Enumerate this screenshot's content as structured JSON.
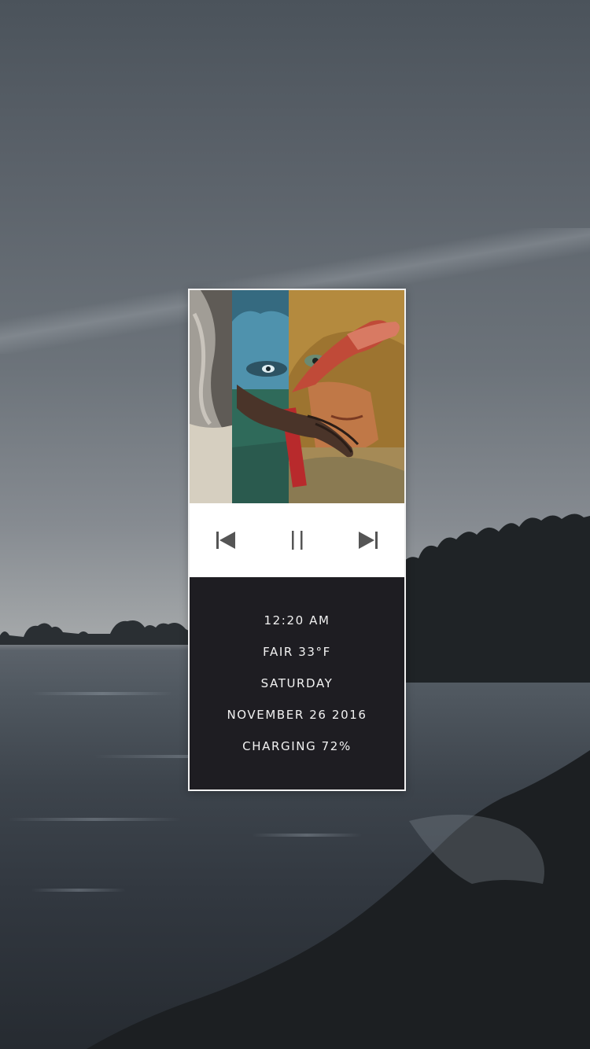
{
  "widget": {
    "controls": {
      "previous_icon": "skip-previous-icon",
      "pause_icon": "pause-icon",
      "next_icon": "skip-next-icon",
      "icon_color": "#555555"
    },
    "info": {
      "time": "12:20 AM",
      "weather": "FAIR 33°F",
      "day": "SATURDAY",
      "date": "NOVEMBER 26 2016",
      "battery": "CHARGING 72%"
    },
    "colors": {
      "controls_bg": "#ffffff",
      "info_bg": "#1e1d22",
      "info_text": "#f2f2f2"
    }
  }
}
